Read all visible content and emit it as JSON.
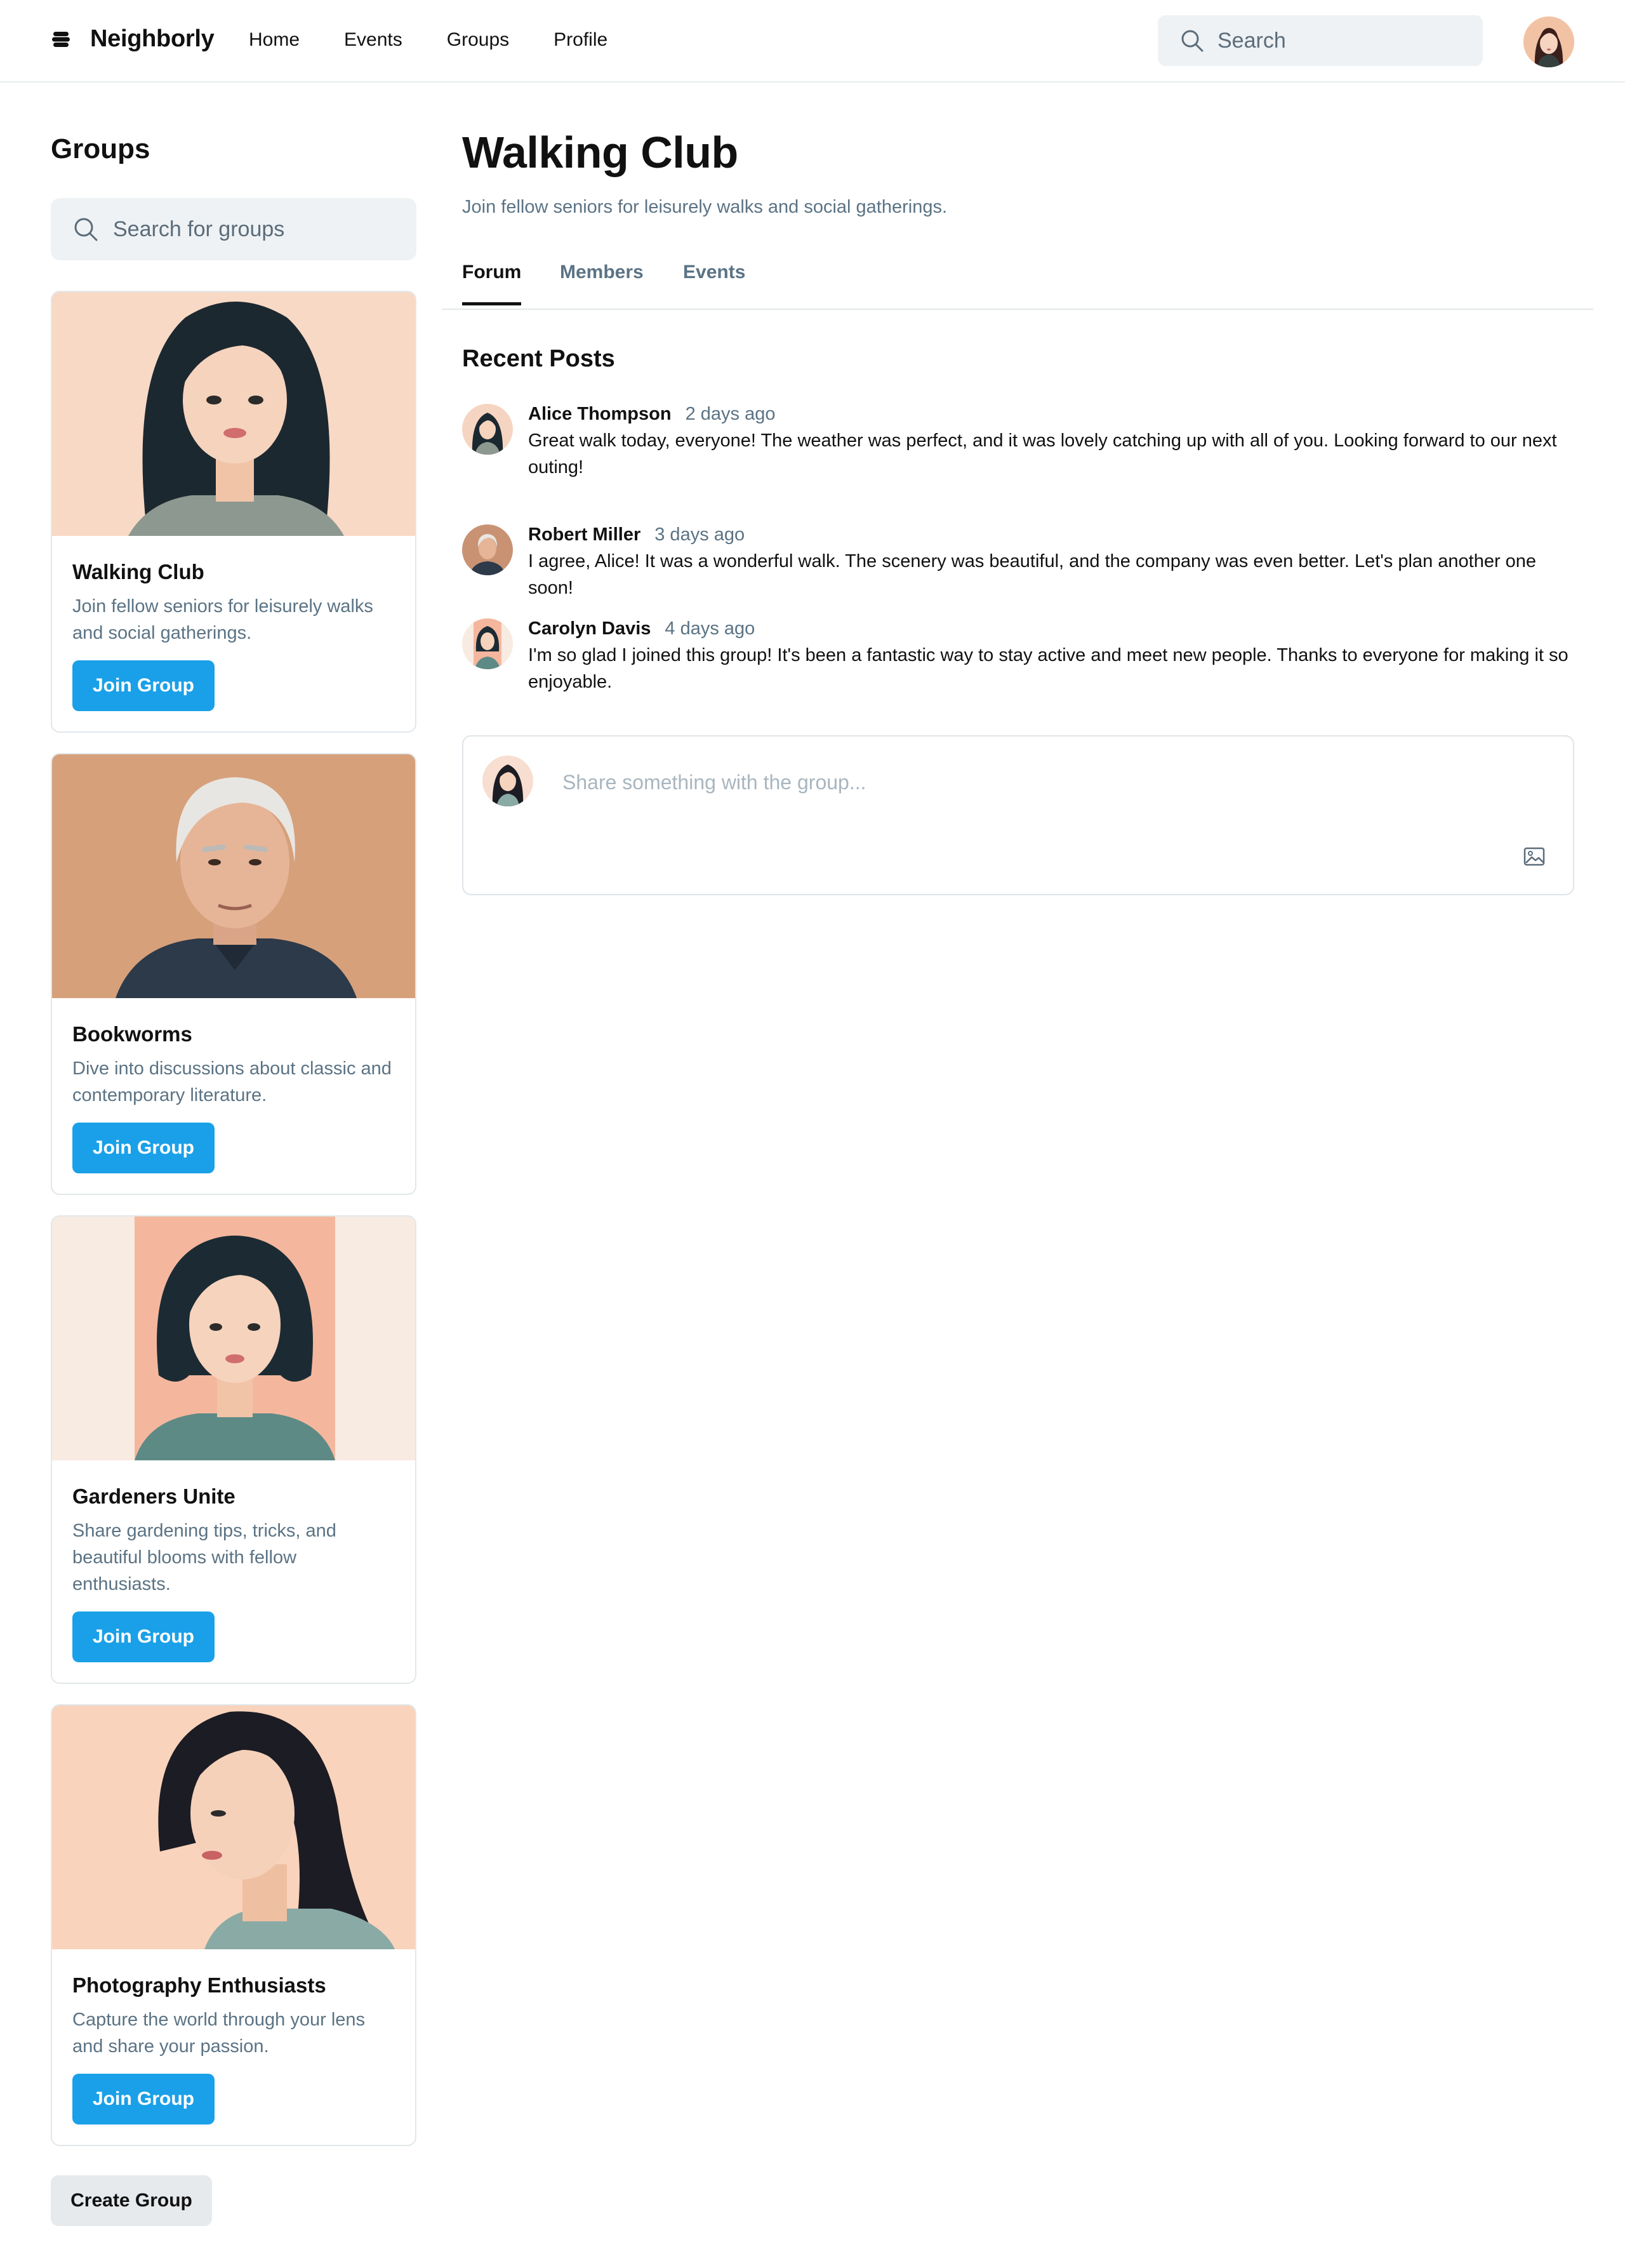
{
  "header": {
    "brand": "Neighborly",
    "nav": [
      "Home",
      "Events",
      "Groups",
      "Profile"
    ],
    "search_placeholder": "Search"
  },
  "sidebar": {
    "title": "Groups",
    "search_placeholder": "Search for groups",
    "groups": [
      {
        "name": "Walking Club",
        "description": "Join fellow seniors for leisurely walks and social gatherings.",
        "button": "Join Group"
      },
      {
        "name": "Bookworms",
        "description": "Dive into discussions about classic and contemporary literature.",
        "button": "Join Group"
      },
      {
        "name": "Gardeners Unite",
        "description": "Share gardening tips, tricks, and beautiful blooms with fellow enthusiasts.",
        "button": "Join Group"
      },
      {
        "name": "Photography Enthusiasts",
        "description": "Capture the world through your lens and share your passion.",
        "button": "Join Group"
      }
    ],
    "create_button": "Create Group"
  },
  "main": {
    "title": "Walking Club",
    "subtitle": "Join fellow seniors for leisurely walks and social gatherings.",
    "tabs": [
      "Forum",
      "Members",
      "Events"
    ],
    "active_tab": "Forum",
    "section_title": "Recent Posts",
    "posts": [
      {
        "author": "Alice Thompson",
        "time": "2 days ago",
        "text": "Great walk today, everyone! The weather was perfect, and it was lovely catching up with all of you. Looking forward to our next outing!"
      },
      {
        "author": "Robert Miller",
        "time": "3 days ago",
        "text": "I agree, Alice! It was a wonderful walk. The scenery was beautiful, and the company was even better. Let's plan another one soon!"
      },
      {
        "author": "Carolyn Davis",
        "time": "4 days ago",
        "text": "I'm so glad I joined this group! It's been a fantastic way to stay active and meet new people. Thanks to everyone for making it so enjoyable."
      }
    ],
    "composer_placeholder": "Share something with the group..."
  },
  "colors": {
    "accent": "#1aa0e8",
    "muted_text": "#5b7384",
    "input_bg": "#eef2f4",
    "border": "#e2e7ea"
  },
  "icons": [
    "logo-icon",
    "search-icon",
    "image-icon"
  ]
}
